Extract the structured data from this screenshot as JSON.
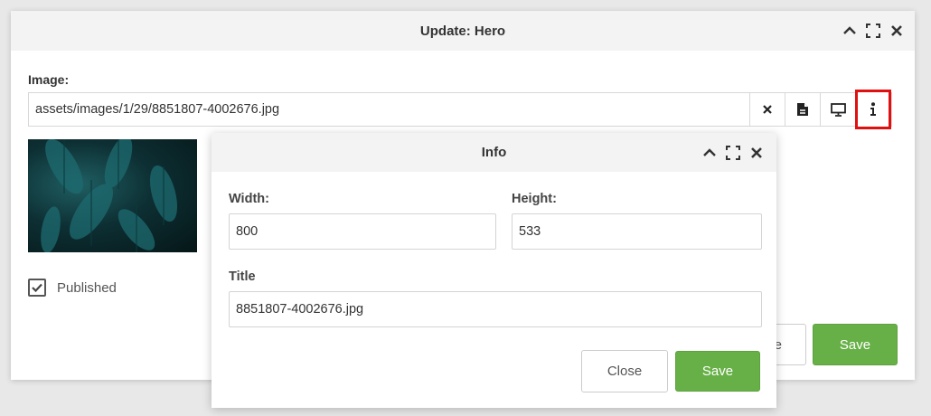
{
  "main_dialog": {
    "title": "Update: Hero",
    "image_label": "Image:",
    "image_path": "assets/images/1/29/8851807-4002676.jpg",
    "published_label": "Published",
    "partial_button_label": "e",
    "save_label": "Save",
    "icons": [
      "chevron-up-icon",
      "maximize-icon",
      "close-icon",
      "clear-icon",
      "file-icon",
      "monitor-icon",
      "info-icon"
    ]
  },
  "info_dialog": {
    "title": "Info",
    "width_label": "Width:",
    "width_value": "800",
    "height_label": "Height:",
    "height_value": "533",
    "title_label": "Title",
    "title_value": "8851807-4002676.jpg",
    "close_label": "Close",
    "save_label": "Save"
  },
  "colors": {
    "success": "#67b047",
    "highlight": "#e01010",
    "titlebar": "#f3f3f3"
  }
}
